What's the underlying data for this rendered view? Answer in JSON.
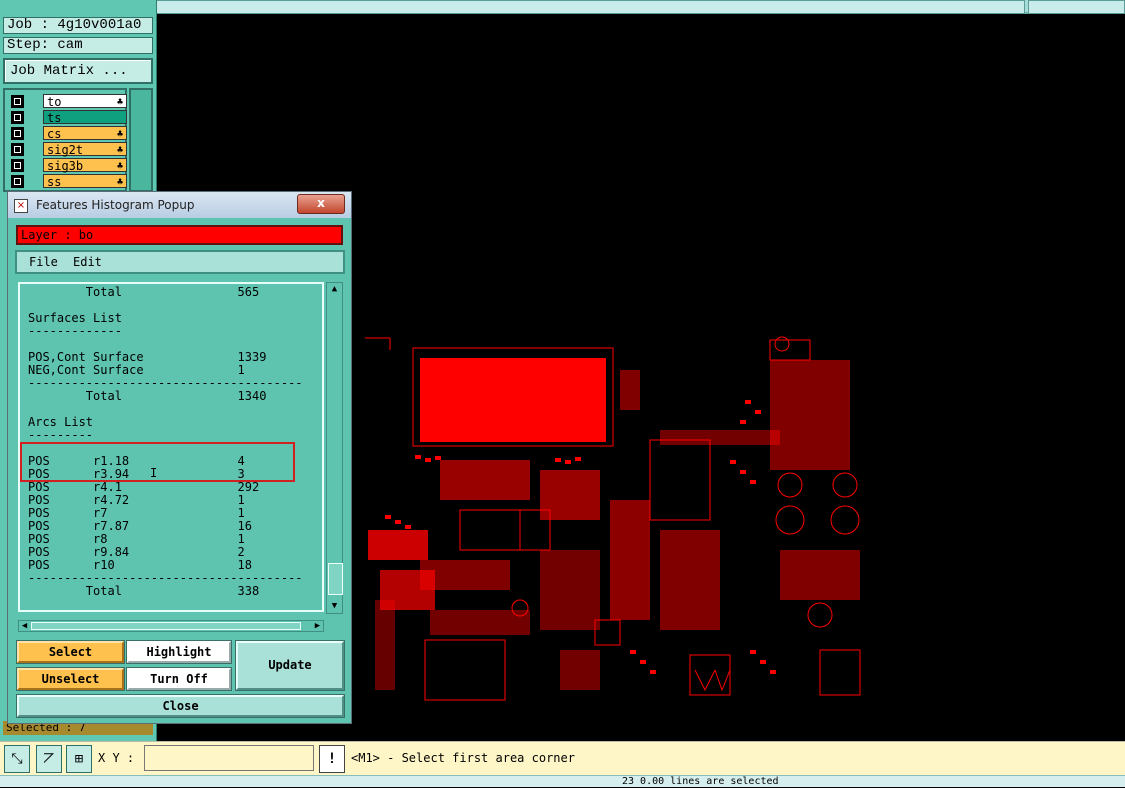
{
  "left_panel": {
    "job_label": "Job : 4g10v001a0",
    "step_label": "Step: cam",
    "job_matrix_button": "Job Matrix ...",
    "layers": [
      {
        "name": "to",
        "color": "#ffffff",
        "leaf": "♣"
      },
      {
        "name": "ts",
        "color": "#0fa080",
        "leaf": ""
      },
      {
        "name": "cs",
        "color": "#ffc14d",
        "leaf": "♣"
      },
      {
        "name": "sig2t",
        "color": "#ffc14d",
        "leaf": "♣"
      },
      {
        "name": "sig3b",
        "color": "#ffc14d",
        "leaf": "♣"
      },
      {
        "name": "ss",
        "color": "#ffc14d",
        "leaf": "♣"
      }
    ],
    "selected_status": "Selected : 7"
  },
  "popup": {
    "title": "Features Histogram Popup",
    "close_glyph": "x",
    "layer_label": "Layer :  bo",
    "menu": {
      "file": "File",
      "edit": "Edit"
    },
    "lines": [
      "        Total                565",
      "",
      "Surfaces List",
      "-------------",
      "",
      "POS,Cont Surface             1339",
      "NEG,Cont Surface             1",
      "--------------------------------------",
      "        Total                1340",
      "",
      "Arcs List",
      "---------",
      "",
      "POS      r1.18               4",
      "POS      r3.94               3",
      "POS      r4.1                292",
      "POS      r4.72               1",
      "POS      r7                  1",
      "POS      r7.87               16",
      "POS      r8                  1",
      "POS      r9.84               2",
      "POS      r10                 18",
      "--------------------------------------",
      "        Total                338"
    ],
    "buttons": {
      "select": "Select",
      "unselect": "Unselect",
      "highlight": "Highlight",
      "turn_off": "Turn Off",
      "update": "Update",
      "close": "Close"
    }
  },
  "bottom": {
    "xy_label": "X Y :",
    "xy_value": "",
    "warn_glyph": "!",
    "prompt": "<M1> - Select first area corner",
    "footer_text": "23  0.00 lines are selected"
  },
  "colors": {
    "panel_teal": "#5ec4b0",
    "layer_red": "#ff0000",
    "highlight_box": "#d02020",
    "status_yellow": "#fff6c8"
  },
  "icons": {
    "tool1": "zoom-area-icon",
    "tool2": "measure-icon",
    "tool3": "snap-grid-icon"
  }
}
